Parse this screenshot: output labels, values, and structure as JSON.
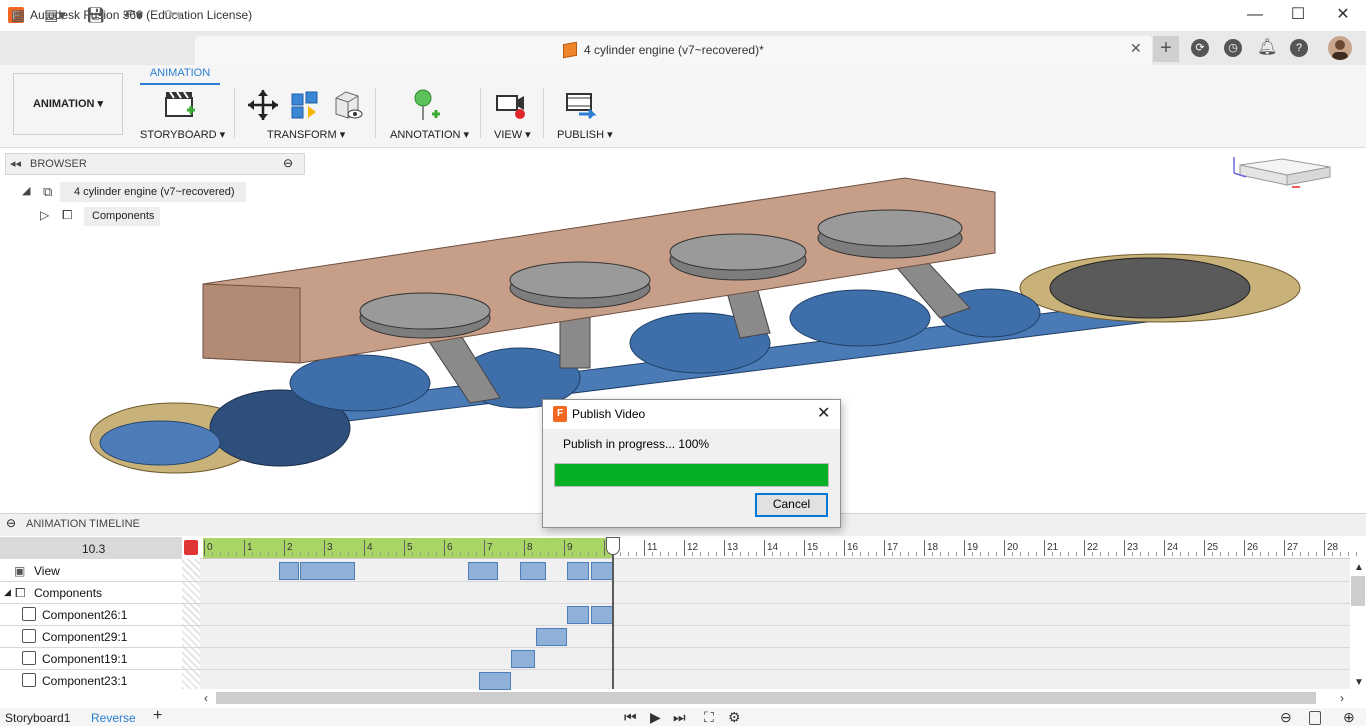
{
  "app": {
    "title": "Autodesk Fusion 360 (Education License)",
    "logo": "F"
  },
  "window": {
    "minimize": "—",
    "maximize": "☐",
    "close": "✕"
  },
  "document": {
    "title": "4 cylinder engine (v7~recovered)*",
    "close": "✕",
    "new_tab": "+"
  },
  "toolbar": {
    "workspace": "ANIMATION",
    "active_tab": "ANIMATION",
    "groups": [
      "STORYBOARD",
      "TRANSFORM",
      "ANNOTATION",
      "VIEW",
      "PUBLISH"
    ]
  },
  "browser": {
    "header": "BROWSER",
    "root": "4 cylinder engine (v7~recovered)",
    "child": "Components"
  },
  "dialog": {
    "title": "Publish Video",
    "message": "Publish in progress... 100%",
    "progress": 1.0,
    "cancel": "Cancel"
  },
  "timeline": {
    "header": "ANIMATION TIMELINE",
    "current_time": "10.3",
    "ticks": [
      "0",
      "1",
      "2",
      "3",
      "4",
      "5",
      "6",
      "7",
      "8",
      "9",
      "10",
      "11",
      "12",
      "13",
      "14",
      "15",
      "16",
      "17",
      "18",
      "19",
      "20",
      "21",
      "22",
      "23",
      "24",
      "25",
      "26",
      "27",
      "28"
    ],
    "rows": [
      "View",
      "Components",
      "Component26:1",
      "Component29:1",
      "Component19:1",
      "Component23:1"
    ]
  },
  "status": {
    "storyboard": "Storyboard1",
    "reverse": "Reverse",
    "add": "+"
  },
  "colors": {
    "accent": "#2a7fd4",
    "progress": "#06b025",
    "timeline_active": "#a8d565",
    "keyframe": "#8fb0d9",
    "brand": "#f26722"
  }
}
